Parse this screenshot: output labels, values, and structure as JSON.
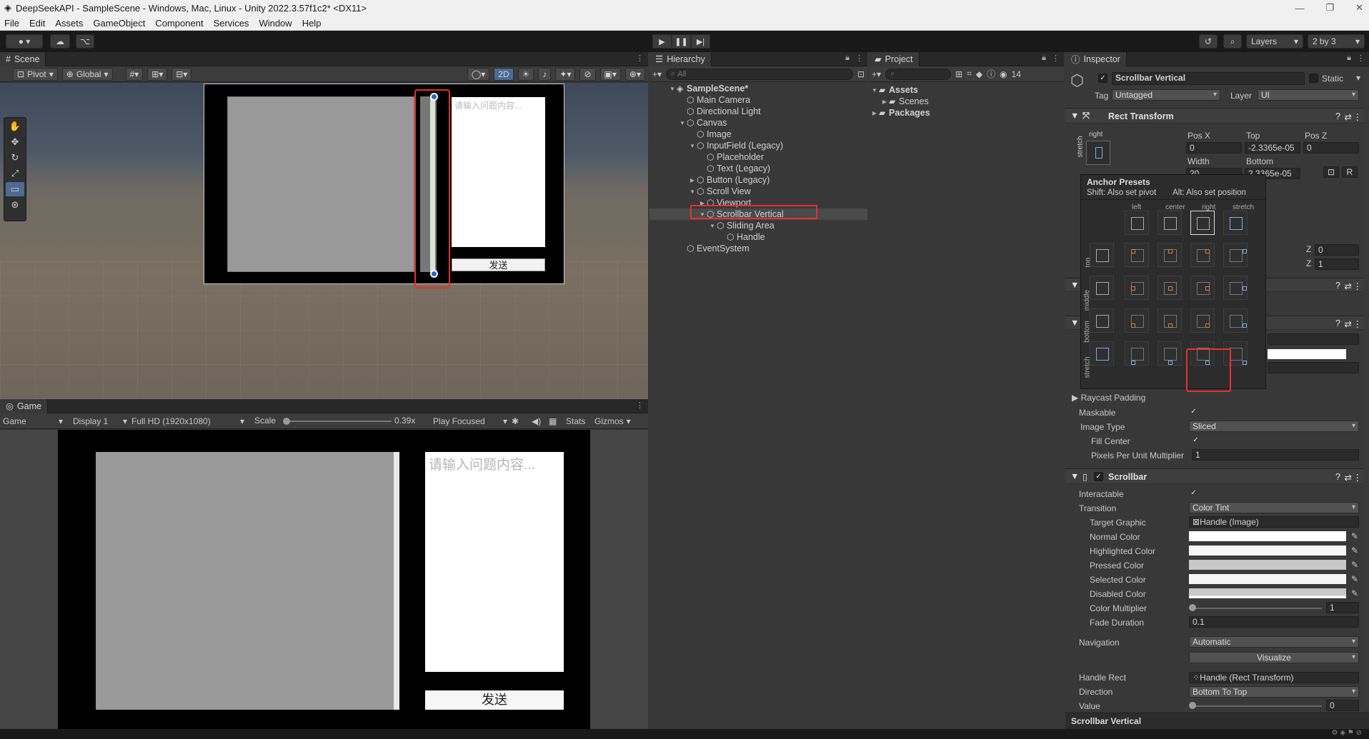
{
  "window": {
    "title": "DeepSeekAPI - SampleScene - Windows, Mac, Linux - Unity 2022.3.57f1c2* <DX11>"
  },
  "menu": [
    "File",
    "Edit",
    "Assets",
    "GameObject",
    "Component",
    "Services",
    "Window",
    "Help"
  ],
  "toolbar": {
    "layers_label": "Layers",
    "layout_label": "2 by 3"
  },
  "scene": {
    "tab": "Scene",
    "pivot_label": "Pivot",
    "global_label": "Global",
    "mode_2d": "2D",
    "input_placeholder": "请输入问题内容...",
    "button_text": "发送"
  },
  "game": {
    "tab": "Game",
    "mode": "Game",
    "display": "Display 1",
    "resolution": "Full HD (1920x1080)",
    "scale_label": "Scale",
    "scale_value": "0.39x",
    "play_mode": "Play Focused",
    "stats": "Stats",
    "gizmos": "Gizmos",
    "input_placeholder": "请输入问题内容...",
    "button_text": "发送"
  },
  "hierarchy": {
    "tab": "Hierarchy",
    "search_placeholder": "All",
    "items": [
      {
        "label": "SampleScene*",
        "depth": 0,
        "arrow": "▼"
      },
      {
        "label": "Main Camera",
        "depth": 1,
        "arrow": ""
      },
      {
        "label": "Directional Light",
        "depth": 1,
        "arrow": ""
      },
      {
        "label": "Canvas",
        "depth": 1,
        "arrow": "▼"
      },
      {
        "label": "Image",
        "depth": 2,
        "arrow": ""
      },
      {
        "label": "InputField (Legacy)",
        "depth": 2,
        "arrow": "▼"
      },
      {
        "label": "Placeholder",
        "depth": 3,
        "arrow": ""
      },
      {
        "label": "Text (Legacy)",
        "depth": 3,
        "arrow": ""
      },
      {
        "label": "Button (Legacy)",
        "depth": 2,
        "arrow": "▶"
      },
      {
        "label": "Scroll View",
        "depth": 2,
        "arrow": "▼"
      },
      {
        "label": "Viewport",
        "depth": 3,
        "arrow": "▶"
      },
      {
        "label": "Scrollbar Vertical",
        "depth": 3,
        "arrow": "▼",
        "selected": true
      },
      {
        "label": "Sliding Area",
        "depth": 4,
        "arrow": "▼"
      },
      {
        "label": "Handle",
        "depth": 5,
        "arrow": ""
      },
      {
        "label": "EventSystem",
        "depth": 1,
        "arrow": ""
      }
    ]
  },
  "project": {
    "tab": "Project",
    "count": "14",
    "items": [
      {
        "label": "Assets",
        "depth": 0,
        "arrow": "▼"
      },
      {
        "label": "Scenes",
        "depth": 1,
        "arrow": "▶"
      },
      {
        "label": "Packages",
        "depth": 0,
        "arrow": "▶"
      }
    ]
  },
  "inspector": {
    "tab": "Inspector",
    "object_name": "Scrollbar Vertical",
    "static_label": "Static",
    "tag_label": "Tag",
    "tag_value": "Untagged",
    "layer_label": "Layer",
    "layer_value": "UI",
    "rect_transform": {
      "title": "Rect Transform",
      "anchor_label": "right",
      "anchor_side": "stretch",
      "pos_x_label": "Pos X",
      "top_label": "Top",
      "pos_z_label": "Pos Z",
      "pos_x": "0",
      "top": "-2.3365e-05",
      "pos_z": "0",
      "width_label": "Width",
      "bottom_label": "Bottom",
      "width": "20",
      "bottom": "2.3365e-05",
      "r_button": "R",
      "z0": "0",
      "z1": "1"
    },
    "anchor_presets": {
      "title": "Anchor Presets",
      "hint_shift": "Shift: Also set pivot",
      "hint_alt": "Alt: Also set position",
      "columns": [
        "left",
        "center",
        "right",
        "stretch"
      ],
      "rows": [
        "top",
        "middle",
        "bottom",
        "stretch"
      ]
    },
    "image": {
      "raycast_padding": "Raycast Padding",
      "maskable": "Maskable",
      "image_type_label": "Image Type",
      "image_type": "Sliced",
      "fill_center": "Fill Center",
      "ppu_label": "Pixels Per Unit Multiplier",
      "ppu": "1"
    },
    "scrollbar": {
      "title": "Scrollbar",
      "interactable": "Interactable",
      "transition_label": "Transition",
      "transition": "Color Tint",
      "target_graphic_label": "Target Graphic",
      "target_graphic": "Handle (Image)",
      "normal_color": "Normal Color",
      "highlighted_color": "Highlighted Color",
      "pressed_color": "Pressed Color",
      "selected_color": "Selected Color",
      "disabled_color": "Disabled Color",
      "color_multiplier_label": "Color Multiplier",
      "color_multiplier": "1",
      "fade_duration_label": "Fade Duration",
      "fade_duration": "0.1",
      "navigation_label": "Navigation",
      "navigation": "Automatic",
      "visualize": "Visualize",
      "handle_rect_label": "Handle Rect",
      "handle_rect": "Handle (Rect Transform)",
      "direction_label": "Direction",
      "direction": "Bottom To Top",
      "value_label": "Value",
      "value": "0"
    },
    "footer": "Scrollbar Vertical"
  },
  "colors": {
    "highlight": "#e8302b",
    "accent": "#4c6a92"
  }
}
